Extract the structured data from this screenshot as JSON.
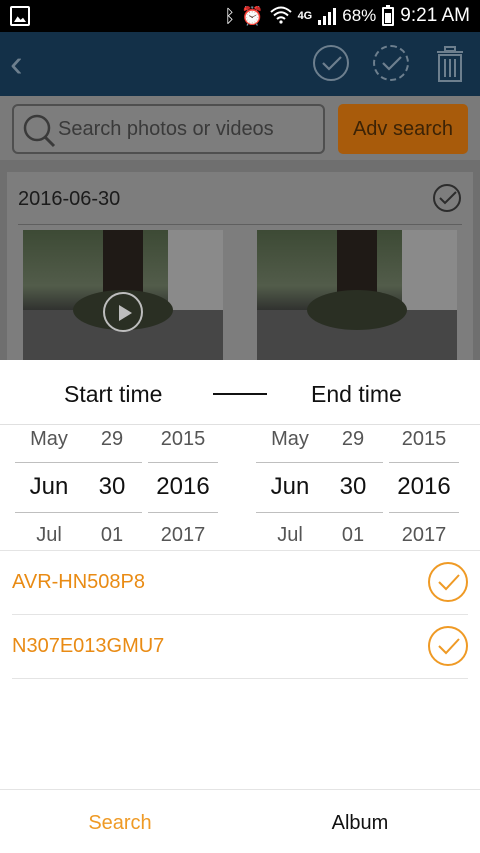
{
  "status_bar": {
    "network": "4G",
    "battery_percent": "68%",
    "time": "9:21 AM",
    "icons": [
      "gallery-icon",
      "bluetooth-icon",
      "alarm-icon",
      "wifi-icon",
      "signal-icon",
      "battery-icon"
    ]
  },
  "app_bar": {
    "icons": [
      "back-icon",
      "select-icon",
      "select-all-icon",
      "trash-icon"
    ]
  },
  "search": {
    "placeholder": "Search photos or videos",
    "adv_label": "Adv search"
  },
  "card": {
    "date": "2016-06-30"
  },
  "sheet": {
    "start_label": "Start time",
    "end_label": "End time",
    "start": {
      "month": {
        "prev": "May",
        "cur": "Jun",
        "next": "Jul"
      },
      "day": {
        "prev": "29",
        "cur": "30",
        "next": "01"
      },
      "year": {
        "prev": "2015",
        "cur": "2016",
        "next": "2017"
      }
    },
    "end": {
      "month": {
        "prev": "May",
        "cur": "Jun",
        "next": "Jul"
      },
      "day": {
        "prev": "29",
        "cur": "30",
        "next": "01"
      },
      "year": {
        "prev": "2015",
        "cur": "2016",
        "next": "2017"
      }
    },
    "devices": [
      {
        "name": "AVR-HN508P8",
        "selected": true
      },
      {
        "name": "N307E013GMU7",
        "selected": true
      }
    ]
  },
  "bottom_nav": {
    "search_label": "Search",
    "album_label": "Album"
  },
  "colors": {
    "accent": "#ef9a25",
    "appbar": "#133048"
  }
}
